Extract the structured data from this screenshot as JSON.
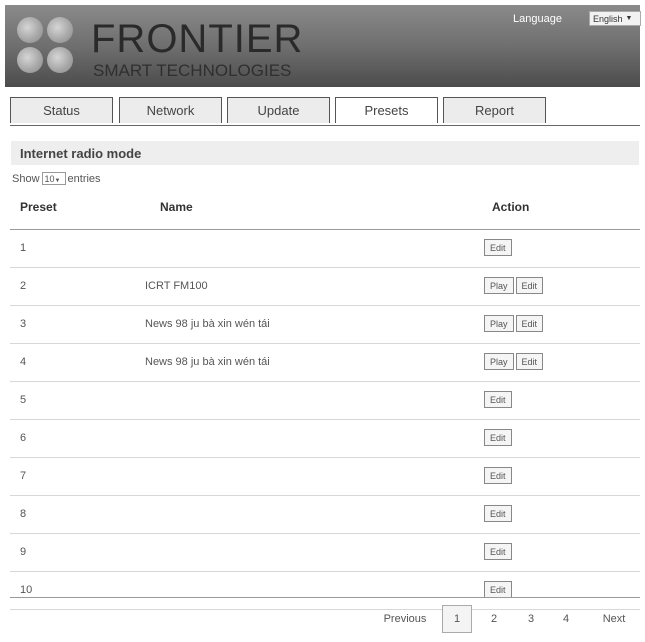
{
  "header": {
    "brand_name": "FRONTIER",
    "brand_sub": "SMART TECHNOLOGIES",
    "language_label": "Language",
    "language_value": "English"
  },
  "tabs": [
    {
      "label": "Status"
    },
    {
      "label": "Network"
    },
    {
      "label": "Update"
    },
    {
      "label": "Presets",
      "active": true
    },
    {
      "label": "Report"
    }
  ],
  "section": {
    "title": "Internet radio mode",
    "show_label": "Show",
    "show_value": "10",
    "entries_label": "entries"
  },
  "table": {
    "columns": {
      "preset": "Preset",
      "name": "Name",
      "action": "Action"
    },
    "rows": [
      {
        "preset": "1",
        "name": "",
        "actions": [
          "Edit"
        ]
      },
      {
        "preset": "2",
        "name": "ICRT FM100",
        "actions": [
          "Play",
          "Edit"
        ]
      },
      {
        "preset": "3",
        "name": "News 98 ju bà xin wén tái",
        "actions": [
          "Play",
          "Edit"
        ]
      },
      {
        "preset": "4",
        "name": "News 98 ju bà xin wén tái",
        "actions": [
          "Play",
          "Edit"
        ]
      },
      {
        "preset": "5",
        "name": "",
        "actions": [
          "Edit"
        ]
      },
      {
        "preset": "6",
        "name": "",
        "actions": [
          "Edit"
        ]
      },
      {
        "preset": "7",
        "name": "",
        "actions": [
          "Edit"
        ]
      },
      {
        "preset": "8",
        "name": "",
        "actions": [
          "Edit"
        ]
      },
      {
        "preset": "9",
        "name": "",
        "actions": [
          "Edit"
        ]
      },
      {
        "preset": "10",
        "name": "",
        "actions": [
          "Edit"
        ]
      }
    ]
  },
  "pagination": {
    "previous": "Previous",
    "pages": [
      "1",
      "2",
      "3",
      "4"
    ],
    "current": "1",
    "next": "Next"
  }
}
